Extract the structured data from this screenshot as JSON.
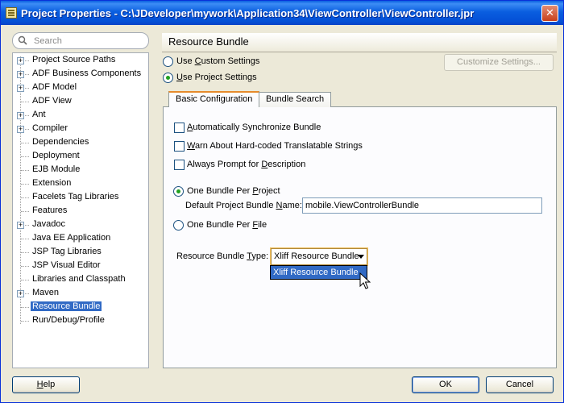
{
  "window": {
    "title": "Project Properties - C:\\JDeveloper\\mywork\\Application34\\ViewController\\ViewController.jpr",
    "close_label": "✕"
  },
  "search": {
    "placeholder": "Search",
    "value": ""
  },
  "tree": {
    "items": [
      {
        "label": "Project Source Paths",
        "expandable": true
      },
      {
        "label": "ADF Business Components",
        "expandable": true
      },
      {
        "label": "ADF Model",
        "expandable": true
      },
      {
        "label": "ADF View",
        "expandable": false
      },
      {
        "label": "Ant",
        "expandable": true
      },
      {
        "label": "Compiler",
        "expandable": true
      },
      {
        "label": "Dependencies",
        "expandable": false
      },
      {
        "label": "Deployment",
        "expandable": false
      },
      {
        "label": "EJB Module",
        "expandable": false
      },
      {
        "label": "Extension",
        "expandable": false
      },
      {
        "label": "Facelets Tag Libraries",
        "expandable": false
      },
      {
        "label": "Features",
        "expandable": false
      },
      {
        "label": "Javadoc",
        "expandable": true
      },
      {
        "label": "Java EE Application",
        "expandable": false
      },
      {
        "label": "JSP Tag Libraries",
        "expandable": false
      },
      {
        "label": "JSP Visual Editor",
        "expandable": false
      },
      {
        "label": "Libraries and Classpath",
        "expandable": false
      },
      {
        "label": "Maven",
        "expandable": true
      },
      {
        "label": "Resource Bundle",
        "expandable": false,
        "selected": true
      },
      {
        "label": "Run/Debug/Profile",
        "expandable": false
      }
    ]
  },
  "panel": {
    "title": "Resource Bundle",
    "use_custom_settings": {
      "before": "Use ",
      "mnemonic": "C",
      "after": "ustom Settings",
      "checked": false
    },
    "use_project_settings": {
      "before": "",
      "mnemonic": "U",
      "after": "se Project Settings",
      "checked": true
    },
    "customize_button": "Customize Settings..."
  },
  "tabs": [
    {
      "label": "Basic Configuration",
      "active": true
    },
    {
      "label": "Bundle Search",
      "active": false
    }
  ],
  "basic": {
    "auto_sync": {
      "before": "",
      "mnemonic": "A",
      "after": "utomatically Synchronize Bundle",
      "checked": false
    },
    "warn_hardcoded": {
      "before": "",
      "mnemonic": "W",
      "after": "arn About Hard-coded Translatable Strings",
      "checked": false
    },
    "always_prompt": {
      "before": "Always Prompt for ",
      "mnemonic": "D",
      "after": "escription",
      "checked": false
    },
    "one_bundle_per_project": {
      "before": "One Bundle Per ",
      "mnemonic": "P",
      "after": "roject",
      "checked": true
    },
    "default_bundle_name_label": {
      "before": "Default Project Bundle ",
      "mnemonic": "N",
      "after": "ame:"
    },
    "default_bundle_name_value": "mobile.ViewControllerBundle",
    "one_bundle_per_file": {
      "before": "One Bundle Per ",
      "mnemonic": "F",
      "after": "ile",
      "checked": false
    },
    "bundle_type_label": {
      "before": "Resource Bundle ",
      "mnemonic": "T",
      "after": "ype:"
    },
    "bundle_type_selected": "Xliff Resource Bundle",
    "bundle_type_options": [
      "Xliff Resource Bundle"
    ]
  },
  "footer": {
    "help": {
      "before": "",
      "mnemonic": "H",
      "after": "elp"
    },
    "ok": "OK",
    "cancel": "Cancel"
  },
  "colors": {
    "title_bar": "#0a5ee0",
    "selection": "#316ac5",
    "dialog_bg": "#ece9d8",
    "tab_accent": "#e68b2c",
    "radio_dot": "#21a121"
  },
  "icons": [
    "search-icon",
    "close-icon",
    "tree-expander-icon",
    "dropdown-arrow-icon",
    "mouse-pointer-icon"
  ]
}
